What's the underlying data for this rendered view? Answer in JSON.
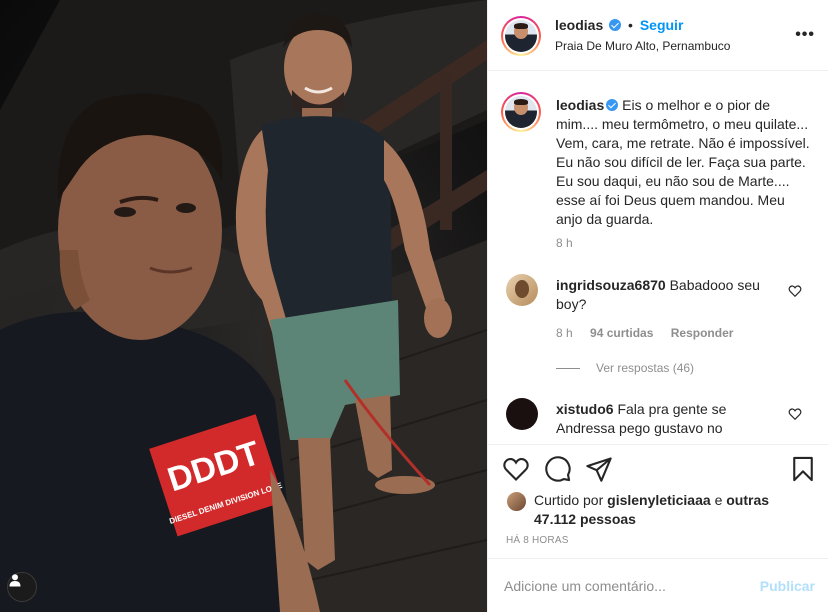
{
  "header": {
    "username": "leodias",
    "separator": "•",
    "follow_label": "Seguir",
    "location": "Praia De Muro Alto, Pernambuco",
    "more_icon": "more-horizontal-icon"
  },
  "caption": {
    "username": "leodias",
    "text": "Eis o melhor e o pior de mim.... meu termômetro, o meu quilate... Vem, cara, me retrate. Não é impossível. Eu não sou difícil de ler. Faça sua parte. Eu sou daqui, eu não sou de Marte.... esse aí foi Deus quem mandou. Meu anjo da guarda.",
    "time": "8 h"
  },
  "comments": [
    {
      "username": "ingridsouza6870",
      "text": "Babadooo seu boy?",
      "time": "8 h",
      "likes": "94 curtidas",
      "reply_label": "Responder",
      "view_replies": "Ver respostas (46)"
    },
    {
      "username": "xistudo6",
      "text": "Fala pra gente se Andressa pego gustavo no"
    }
  ],
  "likes": {
    "prefix": "Curtido por",
    "user": "gislenyleticiaaa",
    "conjunction": "e",
    "others": "outras 47.112 pessoas"
  },
  "timestamp": "HÁ 8 HORAS",
  "add_comment": {
    "placeholder": "Adicione um comentário...",
    "publish_label": "Publicar"
  },
  "photo": {
    "shirt_print": "DDDT",
    "shirt_subtext": "DIESEL DENIM DIVISION LOVE"
  },
  "colors": {
    "accent": "#0095f6",
    "publish_disabled": "#b2dffc",
    "secondary_text": "#8e8e8e",
    "border": "#efefef"
  }
}
